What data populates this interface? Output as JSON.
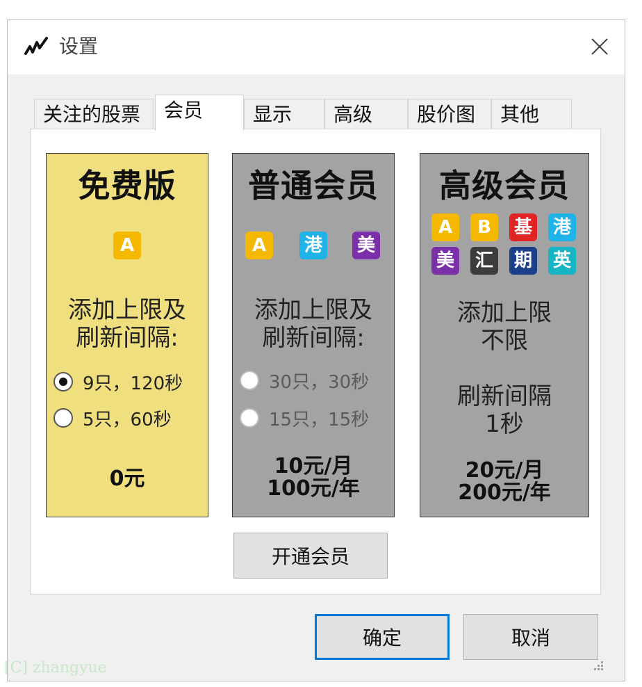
{
  "window": {
    "title": "设置",
    "icon": "stock-chart-icon"
  },
  "tabs": [
    {
      "label": "关注的股票",
      "active": false
    },
    {
      "label": "会员",
      "active": true
    },
    {
      "label": "显示",
      "active": false
    },
    {
      "label": "高级",
      "active": false
    },
    {
      "label": "股价图",
      "active": false
    },
    {
      "label": "其他",
      "active": false
    }
  ],
  "plans": {
    "free": {
      "title": "免费版",
      "bg_color": "#f0df7e",
      "badges": [
        {
          "label": "A",
          "color": "#f5b800"
        }
      ],
      "limit_text": [
        "添加上限及",
        "刷新间隔:"
      ],
      "options": [
        {
          "label": "9只，120秒",
          "checked": true
        },
        {
          "label": "5只，60秒",
          "checked": false
        }
      ],
      "price": [
        "0元"
      ]
    },
    "standard": {
      "title": "普通会员",
      "bg_color": "#a3a3a3",
      "badges": [
        {
          "label": "A",
          "color": "#f5b800"
        },
        {
          "label": "港",
          "color": "#1fb3e8"
        },
        {
          "label": "美",
          "color": "#7b2fa8"
        }
      ],
      "limit_text": [
        "添加上限及",
        "刷新间隔:"
      ],
      "options": [
        {
          "label": "30只，30秒",
          "checked": false
        },
        {
          "label": "15只，15秒",
          "checked": false
        }
      ],
      "price": [
        "10元/月",
        "100元/年"
      ]
    },
    "premium": {
      "title": "高级会员",
      "bg_color": "#a3a3a3",
      "badges": [
        {
          "label": "A",
          "color": "#f5b800"
        },
        {
          "label": "B",
          "color": "#f5b800"
        },
        {
          "label": "基",
          "color": "#e02424"
        },
        {
          "label": "港",
          "color": "#1fb3e8"
        },
        {
          "label": "美",
          "color": "#7b2fa8"
        },
        {
          "label": "汇",
          "color": "#3c3c3c"
        },
        {
          "label": "期",
          "color": "#1b3f88"
        },
        {
          "label": "英",
          "color": "#17b4c4"
        }
      ],
      "limit_text": [
        "添加上限",
        "不限"
      ],
      "refresh_text": [
        "刷新间隔",
        "1秒"
      ],
      "price": [
        "20元/月",
        "200元/年"
      ]
    }
  },
  "buttons": {
    "activate": "开通会员",
    "ok": "确定",
    "cancel": "取消"
  },
  "watermark": "[C] zhangyue",
  "colors": {
    "accent": "#0078d7",
    "window_bg": "#f0f0f0"
  }
}
